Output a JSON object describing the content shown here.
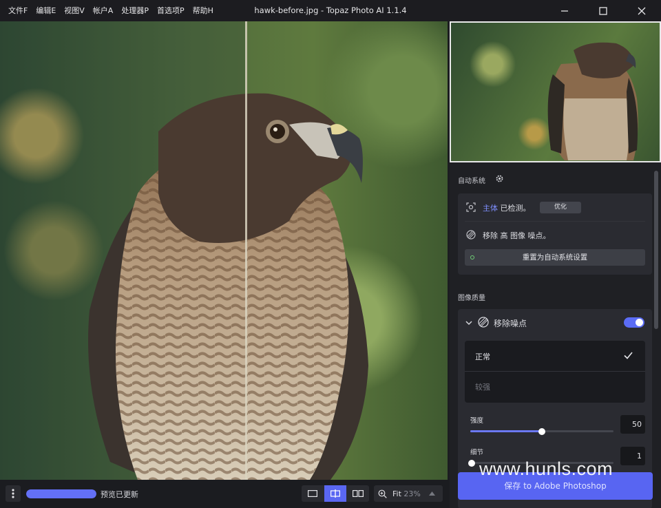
{
  "window": {
    "title": "hawk-before.jpg - Topaz Photo AI 1.1.4"
  },
  "menu": [
    {
      "label": "文件F"
    },
    {
      "label": "编辑E"
    },
    {
      "label": "视图V"
    },
    {
      "label": "帐户A"
    },
    {
      "label": "处理器P"
    },
    {
      "label": "首选项P"
    },
    {
      "label": "帮助H"
    }
  ],
  "window_controls": {
    "minimize": "minimize-icon",
    "maximize": "maximize-icon",
    "close": "close-icon"
  },
  "autopilot": {
    "section_title": "自动系统",
    "subject_label": "主体",
    "subject_status": "已检测。",
    "refine_button": "优化",
    "denoise_text": "移除 高 图像 噪点。",
    "reset_button": "重置为自动系统设置"
  },
  "image_quality": {
    "section_title": "图像质量",
    "denoise": {
      "title": "移除噪点",
      "enabled": true,
      "options": [
        {
          "label": "正常",
          "selected": true
        },
        {
          "label": "较强",
          "selected": false
        }
      ],
      "strength_label": "强度",
      "strength_value": "50",
      "strength_level": 0.5,
      "detail_label": "细节",
      "detail_value": "1",
      "detail_level": 0.01
    }
  },
  "save_button": "保存 to Adobe Photoshop",
  "watermark": "www.hunls.com",
  "bottom": {
    "status_text": "预览已更新",
    "progress": 1.0,
    "zoom_label": "Fit",
    "zoom_percent": "23%"
  },
  "colors": {
    "accent": "#5865f2",
    "panel": "#1f2024",
    "card": "#2a2b31"
  }
}
